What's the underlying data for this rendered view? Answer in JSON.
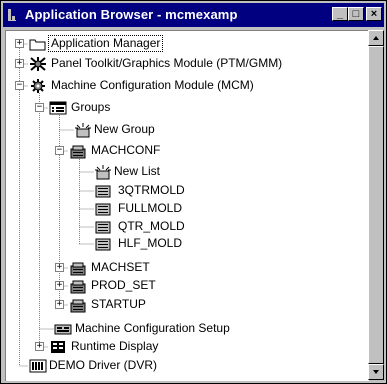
{
  "window": {
    "title": "Application Browser - mcmexamp",
    "controls": {
      "minimize": "_",
      "maximize": "□",
      "close": "×"
    }
  },
  "tree": {
    "items": [
      {
        "label": "Application Manager",
        "icon": "folder-icon",
        "toggle": "+"
      },
      {
        "label": "Panel Toolkit/Graphics Module (PTM/GMM)",
        "icon": "tools-icon",
        "toggle": "+"
      },
      {
        "label": "Machine Configuration Module (MCM)",
        "icon": "gear-icon",
        "toggle": "−"
      },
      {
        "label": "Groups",
        "icon": "list-grid-icon",
        "toggle": "−"
      },
      {
        "label": "New Group",
        "icon": "new-item-icon",
        "toggle": ""
      },
      {
        "label": "MACHCONF",
        "icon": "group-folder-icon",
        "toggle": "−"
      },
      {
        "label": "New List",
        "icon": "new-item-icon",
        "toggle": ""
      },
      {
        "label": "3QTRMOLD",
        "icon": "list-icon",
        "toggle": ""
      },
      {
        "label": "FULLMOLD",
        "icon": "list-icon",
        "toggle": ""
      },
      {
        "label": "QTR_MOLD",
        "icon": "list-icon",
        "toggle": ""
      },
      {
        "label": "HLF_MOLD",
        "icon": "list-icon",
        "toggle": ""
      },
      {
        "label": "MACHSET",
        "icon": "group-folder-icon",
        "toggle": "+"
      },
      {
        "label": "PROD_SET",
        "icon": "group-folder-icon",
        "toggle": "+"
      },
      {
        "label": "STARTUP",
        "icon": "group-folder-icon",
        "toggle": "+"
      },
      {
        "label": "Machine Configuration Setup",
        "icon": "setup-icon",
        "toggle": ""
      },
      {
        "label": "Runtime Display",
        "icon": "display-icon",
        "toggle": "+"
      },
      {
        "label": "DEMO Driver (DVR)",
        "icon": "driver-icon",
        "toggle": ""
      }
    ]
  },
  "scrollbar": {
    "up": "▲",
    "down": "▼"
  }
}
